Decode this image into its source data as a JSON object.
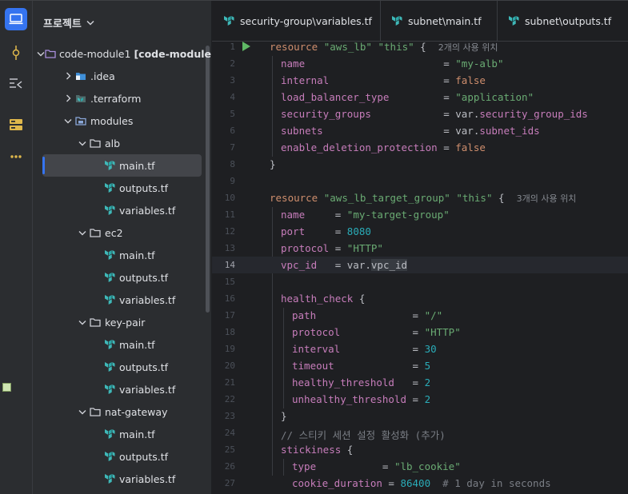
{
  "panel": {
    "title": "프로젝트",
    "tree": [
      {
        "label": "code-module1",
        "bold": "[code-module",
        "icon": "module-folder-icon",
        "expanded": true,
        "depth": 0
      },
      {
        "label": ".idea",
        "icon": "idea-folder-icon",
        "expanded": false,
        "depth": 1
      },
      {
        "label": ".terraform",
        "icon": "terraform-folder-icon",
        "expanded": false,
        "depth": 1
      },
      {
        "label": "modules",
        "icon": "modules-folder-icon",
        "expanded": true,
        "depth": 1
      },
      {
        "label": "alb",
        "icon": "folder-icon",
        "expanded": true,
        "depth": 2
      },
      {
        "label": "main.tf",
        "icon": "terraform-file-icon",
        "depth": 3,
        "selected": true
      },
      {
        "label": "outputs.tf",
        "icon": "terraform-file-icon",
        "depth": 3
      },
      {
        "label": "variables.tf",
        "icon": "terraform-file-icon",
        "depth": 3
      },
      {
        "label": "ec2",
        "icon": "folder-icon",
        "expanded": true,
        "depth": 2
      },
      {
        "label": "main.tf",
        "icon": "terraform-file-icon",
        "depth": 3
      },
      {
        "label": "outputs.tf",
        "icon": "terraform-file-icon",
        "depth": 3
      },
      {
        "label": "variables.tf",
        "icon": "terraform-file-icon",
        "depth": 3
      },
      {
        "label": "key-pair",
        "icon": "folder-icon",
        "expanded": true,
        "depth": 2
      },
      {
        "label": "main.tf",
        "icon": "terraform-file-icon",
        "depth": 3
      },
      {
        "label": "outputs.tf",
        "icon": "terraform-file-icon",
        "depth": 3
      },
      {
        "label": "variables.tf",
        "icon": "terraform-file-icon",
        "depth": 3
      },
      {
        "label": "nat-gateway",
        "icon": "folder-icon",
        "expanded": true,
        "depth": 2
      },
      {
        "label": "main.tf",
        "icon": "terraform-file-icon",
        "depth": 3
      },
      {
        "label": "outputs.tf",
        "icon": "terraform-file-icon",
        "depth": 3
      },
      {
        "label": "variables.tf",
        "icon": "terraform-file-icon",
        "depth": 3
      }
    ]
  },
  "tabs": [
    {
      "label": "security-group\\variables.tf",
      "icon": "terraform-file-icon"
    },
    {
      "label": "subnet\\main.tf",
      "icon": "terraform-file-icon"
    },
    {
      "label": "subnet\\outputs.tf",
      "icon": "terraform-file-icon"
    }
  ],
  "editor": {
    "current_line": 14,
    "lines": [
      {
        "n": "1",
        "indent": 0,
        "tokens": [
          [
            "kw",
            "resource"
          ],
          [
            "t",
            " "
          ],
          [
            "str",
            "\"aws_lb\""
          ],
          [
            "t",
            " "
          ],
          [
            "str",
            "\"this\""
          ],
          [
            "t",
            " {  "
          ],
          [
            "hint",
            "2개의 사용 위치"
          ]
        ]
      },
      {
        "n": "2",
        "indent": 1,
        "tokens": [
          [
            "prop",
            "name"
          ],
          [
            "t",
            "                       = "
          ],
          [
            "str",
            "\"my-alb\""
          ]
        ]
      },
      {
        "n": "3",
        "indent": 1,
        "tokens": [
          [
            "prop",
            "internal"
          ],
          [
            "t",
            "                   = "
          ],
          [
            "kw",
            "false"
          ]
        ]
      },
      {
        "n": "4",
        "indent": 1,
        "tokens": [
          [
            "prop",
            "load_balancer_type"
          ],
          [
            "t",
            "         = "
          ],
          [
            "str",
            "\"application\""
          ]
        ]
      },
      {
        "n": "5",
        "indent": 1,
        "tokens": [
          [
            "prop",
            "security_groups"
          ],
          [
            "t",
            "            = var."
          ],
          [
            "var",
            "security_group_ids"
          ]
        ]
      },
      {
        "n": "6",
        "indent": 1,
        "tokens": [
          [
            "prop",
            "subnets"
          ],
          [
            "t",
            "                    = var."
          ],
          [
            "var",
            "subnet_ids"
          ]
        ]
      },
      {
        "n": "7",
        "indent": 1,
        "tokens": [
          [
            "prop",
            "enable_deletion_protection"
          ],
          [
            "t",
            " = "
          ],
          [
            "kw",
            "false"
          ]
        ]
      },
      {
        "n": "8",
        "indent": 0,
        "tokens": [
          [
            "t",
            "}"
          ]
        ]
      },
      {
        "n": "9",
        "indent": 0,
        "tokens": []
      },
      {
        "n": "10",
        "indent": 0,
        "tokens": [
          [
            "kw",
            "resource"
          ],
          [
            "t",
            " "
          ],
          [
            "str",
            "\"aws_lb_target_group\""
          ],
          [
            "t",
            " "
          ],
          [
            "str",
            "\"this\""
          ],
          [
            "t",
            " {  "
          ],
          [
            "hint",
            "3개의 사용 위치"
          ]
        ]
      },
      {
        "n": "11",
        "indent": 1,
        "tokens": [
          [
            "prop",
            "name"
          ],
          [
            "t",
            "     = "
          ],
          [
            "str",
            "\"my-target-group\""
          ]
        ]
      },
      {
        "n": "12",
        "indent": 1,
        "tokens": [
          [
            "prop",
            "port"
          ],
          [
            "t",
            "     = "
          ],
          [
            "num",
            "8080"
          ]
        ]
      },
      {
        "n": "13",
        "indent": 1,
        "tokens": [
          [
            "prop",
            "protocol"
          ],
          [
            "t",
            " = "
          ],
          [
            "str",
            "\"HTTP\""
          ]
        ]
      },
      {
        "n": "14",
        "indent": 1,
        "tokens": [
          [
            "prop",
            "vpc_id"
          ],
          [
            "t",
            "   = var."
          ],
          [
            "hl",
            "vpc_id"
          ]
        ]
      },
      {
        "n": "15",
        "indent": 0,
        "tokens": []
      },
      {
        "n": "16",
        "indent": 1,
        "tokens": [
          [
            "prop",
            "health_check"
          ],
          [
            "t",
            " {"
          ]
        ]
      },
      {
        "n": "17",
        "indent": 2,
        "tokens": [
          [
            "prop",
            "path"
          ],
          [
            "t",
            "                = "
          ],
          [
            "str",
            "\"/\""
          ]
        ]
      },
      {
        "n": "18",
        "indent": 2,
        "tokens": [
          [
            "prop",
            "protocol"
          ],
          [
            "t",
            "            = "
          ],
          [
            "str",
            "\"HTTP\""
          ]
        ]
      },
      {
        "n": "19",
        "indent": 2,
        "tokens": [
          [
            "prop",
            "interval"
          ],
          [
            "t",
            "            = "
          ],
          [
            "num",
            "30"
          ]
        ]
      },
      {
        "n": "20",
        "indent": 2,
        "tokens": [
          [
            "prop",
            "timeout"
          ],
          [
            "t",
            "             = "
          ],
          [
            "num",
            "5"
          ]
        ]
      },
      {
        "n": "21",
        "indent": 2,
        "tokens": [
          [
            "prop",
            "healthy_threshold"
          ],
          [
            "t",
            "   = "
          ],
          [
            "num",
            "2"
          ]
        ]
      },
      {
        "n": "22",
        "indent": 2,
        "tokens": [
          [
            "prop",
            "unhealthy_threshold"
          ],
          [
            "t",
            " = "
          ],
          [
            "num",
            "2"
          ]
        ]
      },
      {
        "n": "23",
        "indent": 1,
        "tokens": [
          [
            "t",
            "}"
          ]
        ]
      },
      {
        "n": "24",
        "indent": 1,
        "tokens": [
          [
            "cmt",
            "// 스티키 세션 설정 활성화 (추가)"
          ]
        ]
      },
      {
        "n": "25",
        "indent": 1,
        "tokens": [
          [
            "prop",
            "stickiness"
          ],
          [
            "t",
            " {"
          ]
        ]
      },
      {
        "n": "26",
        "indent": 2,
        "tokens": [
          [
            "prop",
            "type"
          ],
          [
            "t",
            "           = "
          ],
          [
            "str",
            "\"lb_cookie\""
          ]
        ]
      },
      {
        "n": "27",
        "indent": 2,
        "tokens": [
          [
            "prop",
            "cookie_duration"
          ],
          [
            "t",
            " = "
          ],
          [
            "num",
            "86400"
          ],
          [
            "t",
            "  "
          ],
          [
            "cmt",
            "# 1 day in seconds"
          ]
        ]
      }
    ]
  }
}
